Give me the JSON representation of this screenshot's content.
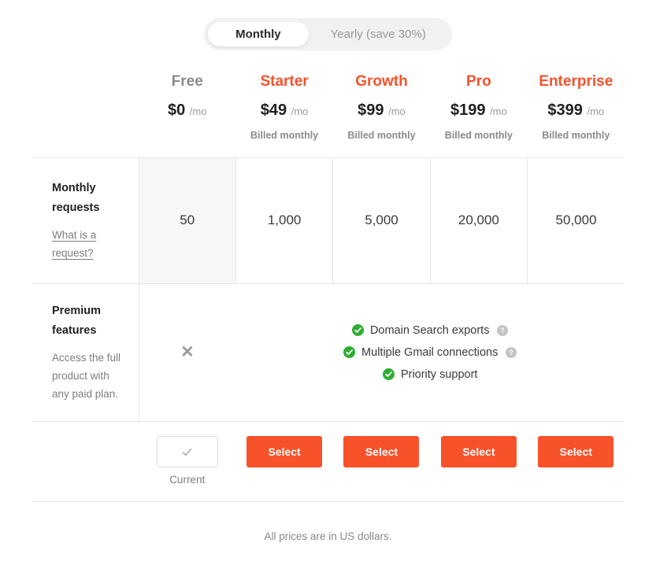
{
  "billing_toggle": {
    "options": [
      {
        "label": "Monthly",
        "active": true
      },
      {
        "label": "Yearly (save 30%)",
        "active": false
      }
    ]
  },
  "colors": {
    "accent": "#f7522a",
    "check_green": "#2fad33",
    "help_gray": "#c4c4c4",
    "muted_text": "#8a8a8a",
    "border": "#e6e6e6",
    "free_cell_bg": "#f6f8f8"
  },
  "plans": [
    {
      "name": "Free",
      "price": "$0",
      "per": "/mo",
      "billed": "",
      "requests": "50",
      "premium": "none",
      "action": "current",
      "action_label": "Current"
    },
    {
      "name": "Starter",
      "price": "$49",
      "per": "/mo",
      "billed": "Billed monthly",
      "requests": "1,000",
      "premium": "included",
      "action": "select",
      "action_label": "Select"
    },
    {
      "name": "Growth",
      "price": "$99",
      "per": "/mo",
      "billed": "Billed monthly",
      "requests": "5,000",
      "premium": "included",
      "action": "select",
      "action_label": "Select"
    },
    {
      "name": "Pro",
      "price": "$199",
      "per": "/mo",
      "billed": "Billed monthly",
      "requests": "20,000",
      "premium": "included",
      "action": "select",
      "action_label": "Select"
    },
    {
      "name": "Enterprise",
      "price": "$399",
      "per": "/mo",
      "billed": "Billed monthly",
      "requests": "50,000",
      "premium": "included",
      "action": "select",
      "action_label": "Select"
    }
  ],
  "rows": {
    "requests": {
      "title": "Monthly requests",
      "link": "What is a request?"
    },
    "premium": {
      "title": "Premium features",
      "subtitle": "Access the full product with any paid plan.",
      "free_marker": "✕",
      "features": [
        {
          "label": "Domain Search exports",
          "has_help": true
        },
        {
          "label": "Multiple Gmail connections",
          "has_help": true
        },
        {
          "label": "Priority support",
          "has_help": false
        }
      ]
    }
  },
  "footer": {
    "note": "All prices are in US dollars."
  }
}
